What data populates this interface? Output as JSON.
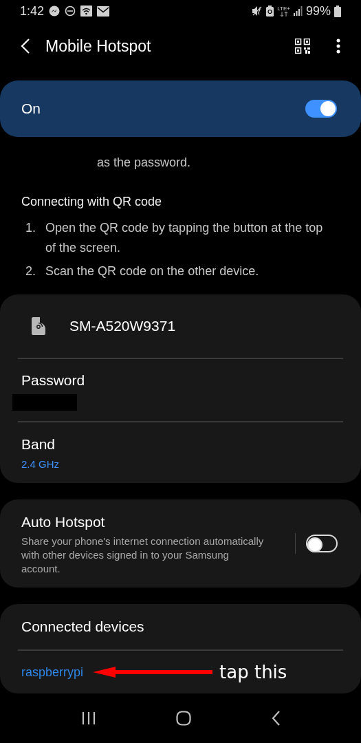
{
  "status_bar": {
    "time": "1:42",
    "network": "LTE+",
    "battery": "99%"
  },
  "header": {
    "title": "Mobile Hotspot"
  },
  "master_switch": {
    "label": "On",
    "on": true
  },
  "instructions": {
    "cut_text": "as the password.",
    "heading": "Connecting with QR code",
    "steps": [
      {
        "number": "1.",
        "text": "Open the QR code by tapping the button at the top of the screen."
      },
      {
        "number": "2.",
        "text": "Scan the QR code on the other device."
      }
    ]
  },
  "network_card": {
    "name": "SM-A520W9371",
    "password": {
      "label": "Password",
      "redacted": true
    },
    "band": {
      "label": "Band",
      "value": "2.4 GHz"
    }
  },
  "auto_hotspot": {
    "title": "Auto Hotspot",
    "description": "Share your phone's internet connection automatically with other devices signed in to your Samsung account.",
    "on": false
  },
  "connected_devices": {
    "heading": "Connected devices",
    "devices": [
      {
        "name": "raspberrypi"
      }
    ]
  },
  "annotation": {
    "text": "tap this"
  }
}
